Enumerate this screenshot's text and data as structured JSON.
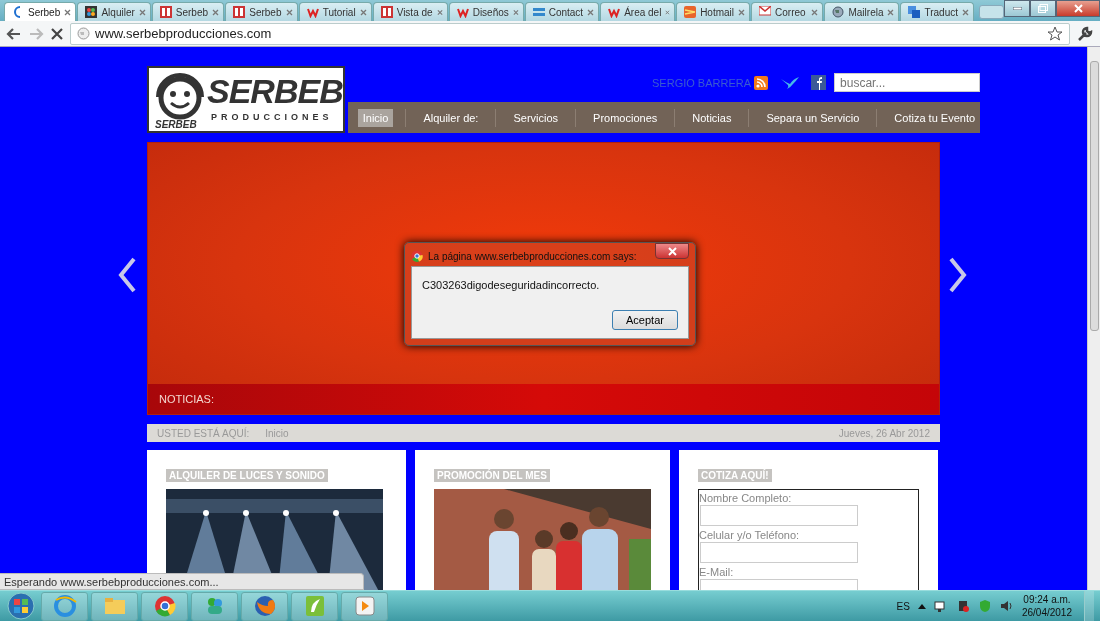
{
  "browser": {
    "tabs": [
      {
        "label": "Serbeb",
        "kind": "loading",
        "selected": true
      },
      {
        "label": "Alquiler",
        "kind": "joomla",
        "selected": false
      },
      {
        "label": "Serbeb",
        "kind": "serbeb",
        "selected": false
      },
      {
        "label": "Serbeb",
        "kind": "serbeb",
        "selected": false
      },
      {
        "label": "Tutorial",
        "kind": "wix",
        "selected": false
      },
      {
        "label": "Vista de",
        "kind": "serbeb",
        "selected": false
      },
      {
        "label": "Diseños",
        "kind": "wix",
        "selected": false
      },
      {
        "label": "Contact",
        "kind": "bars",
        "selected": false
      },
      {
        "label": "Área del",
        "kind": "wix",
        "selected": false
      },
      {
        "label": "Hotmail",
        "kind": "hotmail",
        "selected": false
      },
      {
        "label": "Correo",
        "kind": "gmail",
        "selected": false
      },
      {
        "label": "Mailrela",
        "kind": "globe",
        "selected": false
      },
      {
        "label": "Traduct",
        "kind": "translate",
        "selected": false
      }
    ],
    "url": "www.serbebproducciones.com",
    "status": "Esperando www.serbebproducciones.com..."
  },
  "site": {
    "logo": {
      "title": "SERBEB",
      "subtitle": "PRODUCCIONES",
      "small": "SERBEB"
    },
    "user": "SERGIO BARRERA",
    "search": {
      "placeholder": "buscar..."
    },
    "nav": [
      {
        "label": "Inicio",
        "selected": true
      },
      {
        "label": "Alquiler de:",
        "selected": false
      },
      {
        "label": "Servicios",
        "selected": false
      },
      {
        "label": "Promociones",
        "selected": false
      },
      {
        "label": "Noticias",
        "selected": false
      },
      {
        "label": "Separa un Servicio",
        "selected": false
      },
      {
        "label": "Cotiza tu Evento",
        "selected": false
      }
    ],
    "news_label": "NOTICIAS:",
    "breadcrumb": {
      "label": "USTED ESTÁ AQUÍ:",
      "page": "Inicio",
      "date": "Jueves, 26 Abr 2012"
    },
    "cards": [
      {
        "title": "ALQUILER DE LUCES Y SONIDO",
        "kind": "lights"
      },
      {
        "title": "PROMOCIÓN DEL MES",
        "kind": "people"
      },
      {
        "title": "COTIZA AQUÍ!",
        "kind": "form",
        "fields": [
          "Nombre Completo:",
          "Celular y/o  Teléfono:",
          "E-Mail:"
        ]
      }
    ]
  },
  "dialog": {
    "title": "La página www.serbebproducciones.com says:",
    "message": "C303263digodeseguridadincorrecto.",
    "button": "Aceptar"
  },
  "taskbar": {
    "apps": [
      {
        "kind": "ie"
      },
      {
        "kind": "folder"
      },
      {
        "kind": "chrome"
      },
      {
        "kind": "messenger"
      },
      {
        "kind": "firefox"
      },
      {
        "kind": "leaf"
      },
      {
        "kind": "media"
      }
    ],
    "language": "ES",
    "time": "09:24 a.m.",
    "date": "26/04/2012"
  }
}
